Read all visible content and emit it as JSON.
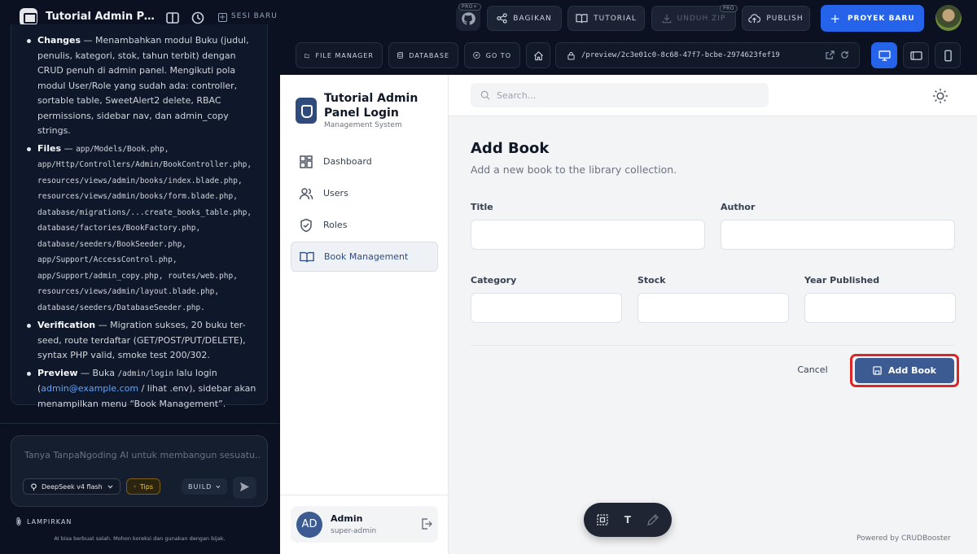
{
  "topbar": {
    "app_title": "Tutorial Admin Panel Login",
    "new_session": "SESI BARU",
    "pro_badge": "PRO+",
    "pro_small": "PRO",
    "share": "BAGIKAN",
    "tutorial": "TUTORIAL",
    "download_zip": "UNDUH ZIP",
    "publish": "PUBLISH",
    "new_project": "PROYEK BARU"
  },
  "chat": {
    "items": [
      {
        "title": "Changes",
        "text": "Menambahkan modul Buku (judul, penulis, kategori, stok, tahun terbit) dengan CRUD penuh di admin panel. Mengikuti pola modul User/Role yang sudah ada: controller, sortable table, SweetAlert2 delete, RBAC permissions, sidebar nav, dan admin_copy strings."
      },
      {
        "title": "Files",
        "text": "app/Models/Book.php, app/Http/Controllers/Admin/BookController.php, resources/views/admin/books/index.blade.php, resources/views/admin/books/form.blade.php, database/migrations/...create_books_table.php, database/factories/BookFactory.php, database/seeders/BookSeeder.php, app/Support/AccessControl.php, app/Support/admin_copy.php, routes/web.php, resources/views/admin/layout.blade.php, database/seeders/DatabaseSeeder.php."
      },
      {
        "title": "Verification",
        "text": "Migration sukses, 20 buku ter-seed, route terdaftar (GET/POST/PUT/DELETE), syntax PHP valid, smoke test 200/302."
      },
      {
        "title": "Preview",
        "text_before": "Buka",
        "code": "/admin/login",
        "text_mid": "lalu login (",
        "link": "admin@example.com",
        "text_after": "/ lihat .env), sidebar akan menampilkan menu “Book Management”."
      }
    ],
    "dash": "—"
  },
  "composer": {
    "placeholder": "Tanya TanpaNgoding AI untuk membangun sesuatu...",
    "model": "DeepSeek v4 flash",
    "tips": "Tips",
    "mode": "BUILD",
    "attach": "LAMPIRKAN",
    "disclaimer": "AI bisa berbuat salah. Mohon koreksi dan gunakan dengan bijak."
  },
  "preview_toolbar": {
    "file_manager": "FILE MANAGER",
    "database": "DATABASE",
    "goto": "GO TO",
    "url": "/preview/2c3e01c0-8c68-47f7-bcbe-2974623fef19"
  },
  "app": {
    "brand_name": "Tutorial Admin Panel Login",
    "brand_sub": "Management System",
    "nav": [
      {
        "label": "Dashboard",
        "icon": "dashboard-icon"
      },
      {
        "label": "Users",
        "icon": "users-icon"
      },
      {
        "label": "Roles",
        "icon": "shield-icon"
      },
      {
        "label": "Book Management",
        "icon": "book-icon"
      }
    ],
    "user": {
      "initials": "AD",
      "name": "Admin",
      "role": "super-admin"
    },
    "search_placeholder": "Search...",
    "page_title": "Add Book",
    "page_subtitle": "Add a new book to the library collection.",
    "fields": {
      "title": "Title",
      "author": "Author",
      "category": "Category",
      "stock": "Stock",
      "year": "Year Published"
    },
    "cancel": "Cancel",
    "submit": "Add Book",
    "powered": "Powered by CRUDBooster",
    "float_text_tool": "T"
  },
  "colors": {
    "accent": "#2563eb",
    "app_primary": "#3b5b92",
    "highlight_ring": "#dc2626",
    "dark_bg": "#0b1120"
  }
}
